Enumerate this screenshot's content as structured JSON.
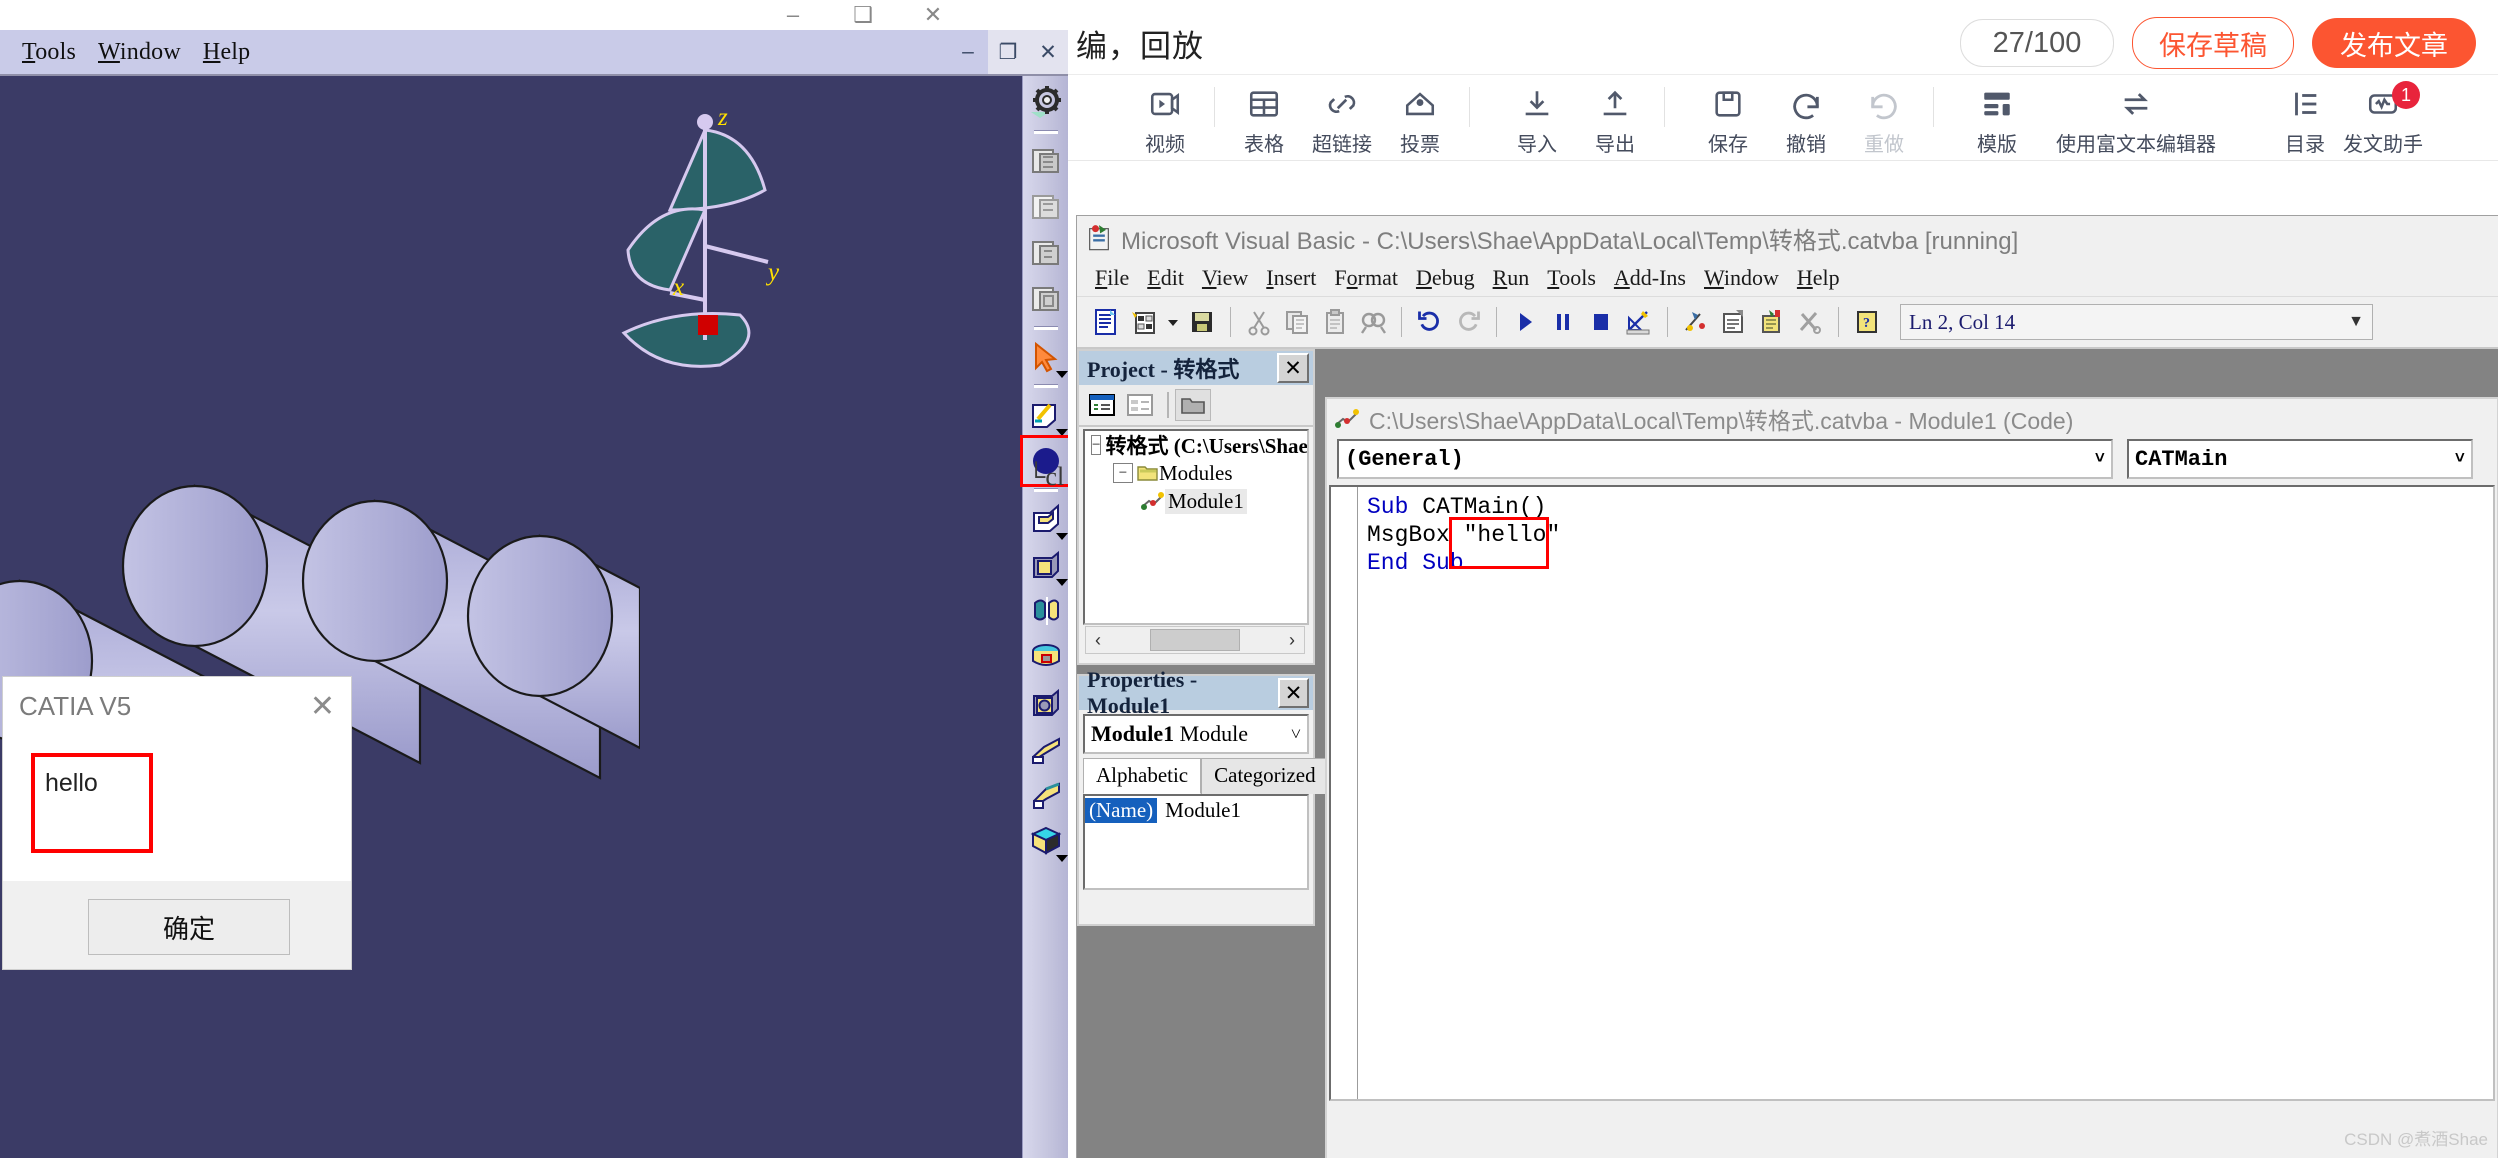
{
  "catia": {
    "menu": [
      {
        "label": "Tools",
        "accel": "T"
      },
      {
        "label": "Window",
        "accel": "W"
      },
      {
        "label": "Help",
        "accel": "H"
      }
    ],
    "window_buttons": [
      {
        "name": "minimize",
        "glyph": "–"
      },
      {
        "name": "restore",
        "glyph": "❐"
      },
      {
        "name": "close",
        "glyph": "✕"
      }
    ],
    "outer_window_buttons": [
      {
        "name": "minimize",
        "glyph": "–"
      },
      {
        "name": "restore",
        "glyph": "❑"
      },
      {
        "name": "close",
        "glyph": "✕"
      }
    ],
    "axis": {
      "x_label": "x",
      "y_label": "y",
      "z_label": "z"
    },
    "click_hint": "└cl",
    "background_color": "#3b3b66",
    "highlight_color": "#ff0000",
    "toolbar_icons": [
      "gear-icon",
      "separator",
      "catalog-icon",
      "catalog2-icon",
      "catalog3-icon",
      "catalog4-icon",
      "separator",
      "select-arrow-icon",
      "separator",
      "sketch-icon",
      "circle-shape-icon",
      "separator",
      "pad-icon",
      "pocket-icon",
      "shaft-icon",
      "groove-icon",
      "hole-icon",
      "rib-icon",
      "slot-icon",
      "multisection-icon"
    ]
  },
  "dialog": {
    "title": "CATIA V5",
    "close_glyph": "✕",
    "message": "hello",
    "ok_label": "确定"
  },
  "editor": {
    "title": "编，回放",
    "char_count": "27/100",
    "save_draft_label": "保存草稿",
    "publish_label": "发布文章",
    "accent_color": "#fc5531",
    "toolbar": [
      {
        "name": "video",
        "label": "视频",
        "icon": "video-icon",
        "disabled": false
      },
      {
        "name": "divider",
        "label": "",
        "icon": "divider",
        "disabled": false
      },
      {
        "name": "table",
        "label": "表格",
        "icon": "table-icon",
        "disabled": false
      },
      {
        "name": "hyperlink",
        "label": "超链接",
        "icon": "link-icon",
        "disabled": false
      },
      {
        "name": "vote",
        "label": "投票",
        "icon": "vote-icon",
        "disabled": false
      },
      {
        "name": "divider",
        "label": "",
        "icon": "divider",
        "disabled": false
      },
      {
        "name": "import",
        "label": "导入",
        "icon": "download-icon",
        "disabled": false
      },
      {
        "name": "export",
        "label": "导出",
        "icon": "upload-icon",
        "disabled": false
      },
      {
        "name": "divider",
        "label": "",
        "icon": "divider",
        "disabled": false
      },
      {
        "name": "save",
        "label": "保存",
        "icon": "save-icon",
        "disabled": false
      },
      {
        "name": "undo",
        "label": "撤销",
        "icon": "undo-icon",
        "disabled": false
      },
      {
        "name": "redo",
        "label": "重做",
        "icon": "redo-icon",
        "disabled": true
      },
      {
        "name": "divider",
        "label": "",
        "icon": "divider",
        "disabled": false
      },
      {
        "name": "template",
        "label": "模版",
        "icon": "template-icon",
        "disabled": false
      },
      {
        "name": "rich-text-editor",
        "label": "使用富文本编辑器",
        "icon": "switch-icon",
        "disabled": false
      },
      {
        "name": "catalog",
        "label": "目录",
        "icon": "list-icon",
        "disabled": false
      },
      {
        "name": "post-assistant",
        "label": "发文助手",
        "icon": "assistant-icon",
        "disabled": false,
        "badge": "1"
      }
    ]
  },
  "vb": {
    "title": "Microsoft Visual Basic - C:\\Users\\Shae\\AppData\\Local\\Temp\\转格式.catvba [running]",
    "menu": [
      "File",
      "Edit",
      "View",
      "Insert",
      "Format",
      "Debug",
      "Run",
      "Tools",
      "Add-Ins",
      "Window",
      "Help"
    ],
    "position_indicator": "Ln 2, Col 14",
    "toolbar_icons": [
      "view-code-icon",
      "insert-userform-icon",
      "dropdown-caret",
      "save-icon",
      "cut-icon",
      "copy-icon",
      "paste-icon",
      "find-icon",
      "undo-icon",
      "redo-icon",
      "run-icon",
      "break-icon",
      "reset-icon",
      "design-mode-icon",
      "project-explorer-icon",
      "properties-window-icon",
      "object-browser-icon",
      "toolbox-icon",
      "help-icon"
    ],
    "project_panel": {
      "title": "Project - 转格式",
      "close_glyph": "✕",
      "toolbar_icons": [
        "view-code-icon",
        "view-object-icon",
        "toggle-folders-icon"
      ],
      "tree": [
        {
          "level": 0,
          "label": "转格式 (C:\\Users\\Shae",
          "icon": "project-icon",
          "expander": "−",
          "selected": false
        },
        {
          "level": 1,
          "label": "Modules",
          "icon": "folder-icon",
          "expander": "−",
          "selected": false
        },
        {
          "level": 2,
          "label": "Module1",
          "icon": "module-icon",
          "expander": "",
          "selected": true
        }
      ]
    },
    "properties_panel": {
      "title": "Properties - Module1",
      "close_glyph": "✕",
      "combo_value_bold": "Module1",
      "combo_value_rest": "Module",
      "tabs": [
        {
          "label": "Alphabetic",
          "active": true
        },
        {
          "label": "Categorized",
          "active": false
        }
      ],
      "rows": [
        {
          "key": "(Name)",
          "value": "Module1"
        }
      ]
    },
    "code_window": {
      "title": "C:\\Users\\Shae\\AppData\\Local\\Temp\\转格式.catvba - Module1 (Code)",
      "left_combo": "(General)",
      "right_combo": "CATMain",
      "lines": [
        {
          "indent": 0,
          "tokens": [
            {
              "t": "Sub ",
              "k": true
            },
            {
              "t": "CATMain()",
              "k": false
            }
          ]
        },
        {
          "indent": 0,
          "tokens": [
            {
              "t": "MsgBox ",
              "k": false
            },
            {
              "t": "\"hello\"",
              "k": false
            }
          ]
        },
        {
          "indent": 0,
          "tokens": [
            {
              "t": "End Sub",
              "k": true
            }
          ]
        }
      ]
    }
  },
  "watermark": "CSDN @煮酒Shae"
}
